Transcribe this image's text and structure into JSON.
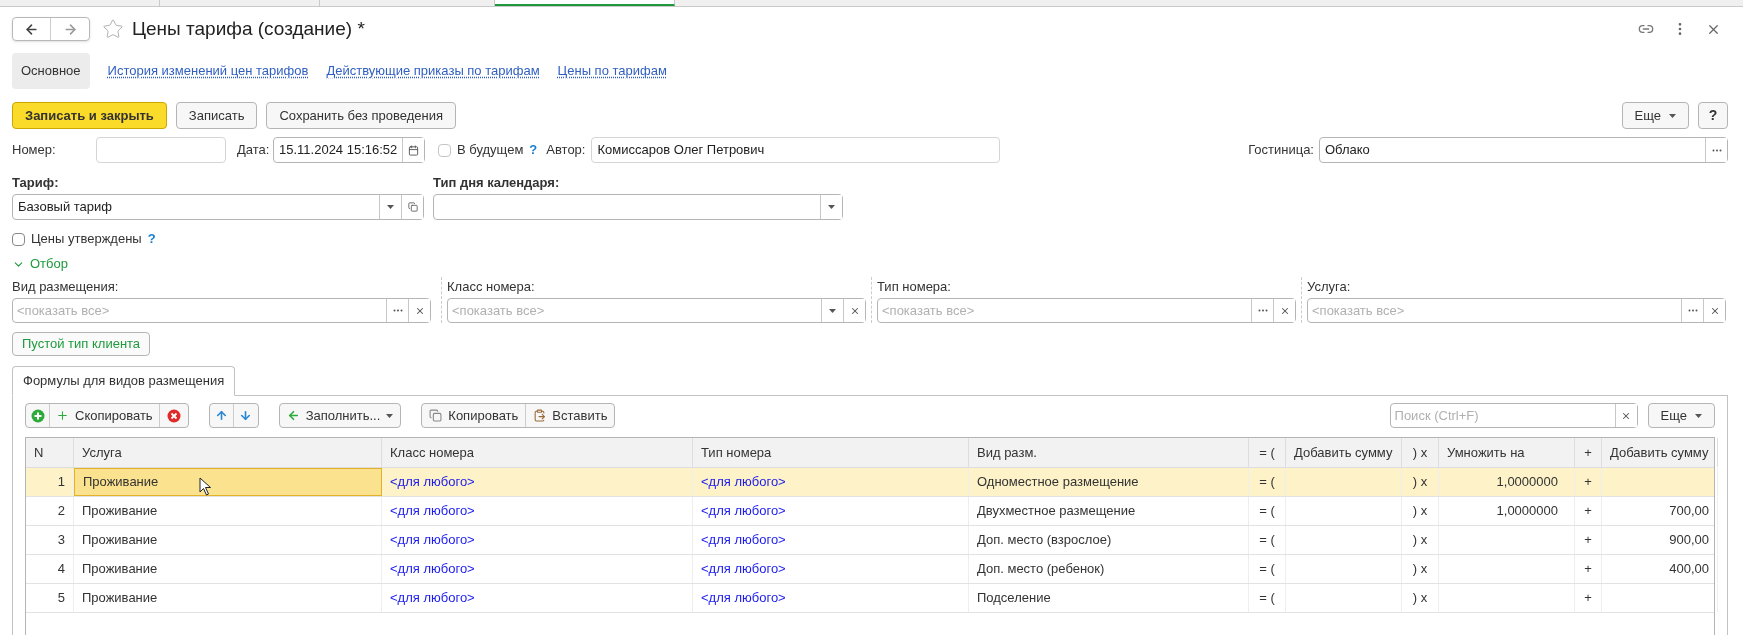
{
  "window": {
    "title": "Цены тарифа (создание) *"
  },
  "nav_tabs": [
    {
      "label": "Основное",
      "selected": true
    },
    {
      "label": "История изменений цен тарифов",
      "selected": false
    },
    {
      "label": "Действующие приказы по тарифам",
      "selected": false
    },
    {
      "label": "Цены по тарифам",
      "selected": false
    }
  ],
  "command_bar": {
    "buttons": [
      {
        "label": "Записать и закрыть",
        "kind": "primary"
      },
      {
        "label": "Записать",
        "kind": "default"
      },
      {
        "label": "Сохранить без проведения",
        "kind": "default"
      }
    ],
    "more": "Еще",
    "help": "?"
  },
  "header": {
    "number": {
      "label": "Номер:"
    },
    "date": {
      "label": "Дата:",
      "value": "15.11.2024 15:16:52"
    },
    "in_future": {
      "label": "В будущем",
      "checked": false,
      "hint": "?"
    },
    "author": {
      "label": "Автор:",
      "value": "Комиссаров Олег Петрович"
    },
    "hotel": {
      "label": "Гостиница:",
      "value": "Облако"
    }
  },
  "tariff": {
    "label": "Тариф:",
    "value": "Базовый тариф"
  },
  "calendar_day_type": {
    "label": "Тип дня календаря:"
  },
  "prices_approved": {
    "label": "Цены утверждены",
    "checked": false,
    "hint": "?"
  },
  "filter": {
    "label": "Отбор",
    "expanded": true,
    "fields": [
      {
        "label": "Вид размещения:",
        "placeholder": "<показать все>",
        "kind": "choice"
      },
      {
        "label": "Класс номера:",
        "placeholder": "<показать все>",
        "kind": "dropdown"
      },
      {
        "label": "Тип номера:",
        "placeholder": "<показать все>",
        "kind": "choice"
      },
      {
        "label": "Услуга:",
        "placeholder": "<показать все>",
        "kind": "choice"
      }
    ]
  },
  "empty_client_type_button": "Пустой тип клиента",
  "table_tabs": [
    {
      "label": "Формулы для видов размещения",
      "selected": true
    }
  ],
  "table_toolbar": {
    "copy_row": "Скопировать",
    "fill": "Заполнить...",
    "copy": "Копировать",
    "paste": "Вставить",
    "search_placeholder": "Поиск (Ctrl+F)",
    "more": "Еще"
  },
  "table": {
    "columns": [
      "N",
      "Услуга",
      "Класс номера",
      "Тип номера",
      "Вид разм.",
      "= (",
      "Добавить сумму",
      ") x",
      "Умножить на",
      "+",
      "Добавить сумму"
    ],
    "rows": [
      {
        "selected": true,
        "cells": {
          "n": "1",
          "service": {
            "text": "Проживание",
            "focused": true
          },
          "room_class": "<для любого>",
          "room_type": "<для любого>",
          "placement": "Одноместное размещение",
          "eq": "= (",
          "mul": ") x",
          "multiply": "1,0000000",
          "plus": "+"
        }
      },
      {
        "selected": false,
        "cells": {
          "n": "2",
          "service": {
            "text": "Проживание",
            "focused": false
          },
          "room_class": "<для любого>",
          "room_type": "<для любого>",
          "placement": "Двухместное размещение",
          "eq": "= (",
          "mul": ") x",
          "multiply": "1,0000000",
          "plus": "+",
          "add_sum_2": "700,00"
        }
      },
      {
        "selected": false,
        "cells": {
          "n": "3",
          "service": {
            "text": "Проживание",
            "focused": false
          },
          "room_class": "<для любого>",
          "room_type": "<для любого>",
          "placement": "Доп. место (взрослое)",
          "eq": "= (",
          "mul": ") x",
          "plus": "+",
          "add_sum_2": "900,00"
        }
      },
      {
        "selected": false,
        "cells": {
          "n": "4",
          "service": {
            "text": "Проживание",
            "focused": false
          },
          "room_class": "<для любого>",
          "room_type": "<для любого>",
          "placement": "Доп. место (ребенок)",
          "eq": "= (",
          "mul": ") x",
          "plus": "+",
          "add_sum_2": "400,00"
        }
      },
      {
        "selected": false,
        "cells": {
          "n": "5",
          "service": {
            "text": "Проживание",
            "focused": false
          },
          "room_class": "<для любого>",
          "room_type": "<для любого>",
          "placement": "Подселение",
          "eq": "= (",
          "mul": ") x",
          "plus": "+"
        }
      }
    ]
  }
}
